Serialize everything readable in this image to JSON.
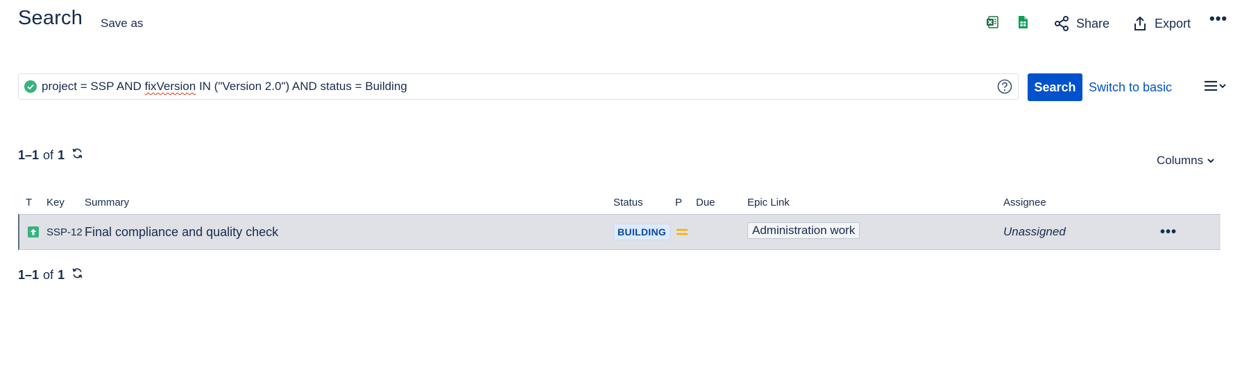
{
  "header": {
    "title": "Search",
    "save_as": "Save as",
    "share_label": "Share",
    "export_label": "Export",
    "more_label": "•••"
  },
  "jql": {
    "query_prefix": "project = SSP AND ",
    "query_spell": "fixVersion",
    "query_suffix": " IN (\"Version 2.0\") AND status = Building",
    "search_label": "Search",
    "switch_label": "Switch to basic"
  },
  "pager": {
    "range": "1–1",
    "of": "of",
    "total": "1"
  },
  "columns_label": "Columns",
  "table": {
    "headers": {
      "type": "T",
      "key": "Key",
      "summary": "Summary",
      "status": "Status",
      "priority": "P",
      "due": "Due",
      "epic": "Epic Link",
      "assignee": "Assignee"
    },
    "rows": [
      {
        "type_icon": "improvement-icon",
        "key": "SSP-12",
        "summary": "Final compliance and quality check",
        "status": "BUILDING",
        "priority_icon": "medium-priority-icon",
        "due": "",
        "epic": "Administration work",
        "assignee": "Unassigned",
        "actions": "•••"
      }
    ]
  },
  "colors": {
    "primary": "#0052cc",
    "text": "#172b4d",
    "row_bg": "#dfe1e6",
    "status_bg": "#deebff",
    "status_text": "#0747a6",
    "excel_green": "#1d6f42",
    "sheets_green": "#0f9d58",
    "ok_green": "#36b37e",
    "priority_orange": "#ffab00"
  }
}
